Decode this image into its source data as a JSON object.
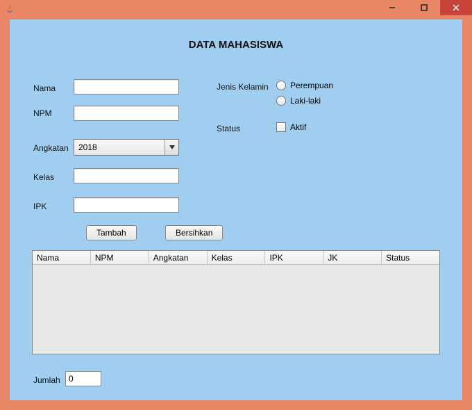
{
  "window": {
    "title": ""
  },
  "header": {
    "title": "DATA MAHASISWA"
  },
  "form": {
    "nama": {
      "label": "Nama",
      "value": ""
    },
    "npm": {
      "label": "NPM",
      "value": ""
    },
    "angkatan": {
      "label": "Angkatan",
      "selected": "2018"
    },
    "kelas": {
      "label": "Kelas",
      "value": ""
    },
    "ipk": {
      "label": "IPK",
      "value": ""
    },
    "jenis_kelamin": {
      "label": "Jenis Kelamin",
      "options": {
        "perempuan": "Perempuan",
        "laki": "Laki-laki"
      }
    },
    "status": {
      "label": "Status",
      "aktif_label": "Aktif"
    }
  },
  "buttons": {
    "tambah": "Tambah",
    "bersihkan": "Bersihkan"
  },
  "table": {
    "headers": {
      "nama": "Nama",
      "npm": "NPM",
      "angkatan": "Angkatan",
      "kelas": "Kelas",
      "ipk": "IPK",
      "jk": "JK",
      "status": "Status"
    }
  },
  "footer": {
    "jumlah_label": "Jumlah",
    "jumlah_value": "0"
  }
}
